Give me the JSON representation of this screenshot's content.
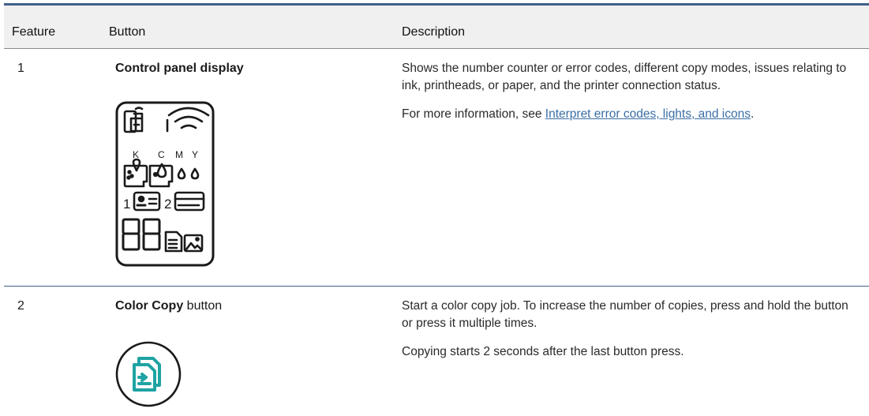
{
  "table": {
    "headers": {
      "feature": "Feature",
      "button": "Button",
      "description": "Description"
    },
    "rows": [
      {
        "feature": "1",
        "button_bold": "Control panel display",
        "button_rest": "",
        "description": [
          "Shows the number counter or error codes, different copy modes, issues relating to ink, printheads, or paper, and the printer connection status."
        ],
        "more_prefix": "For more information, see ",
        "more_link": "Interpret error codes, lights, and icons",
        "more_suffix": ".",
        "icon": "control-panel-display-icon",
        "panel_labels": {
          "k": "K",
          "c": "C",
          "m": "M",
          "y": "Y",
          "one": "1",
          "two": "2"
        }
      },
      {
        "feature": "2",
        "button_bold": "Color Copy",
        "button_rest": " button",
        "description": [
          "Start a color copy job. To increase the number of copies, press and hold the button or press it multiple times.",
          "Copying starts 2 seconds after the last button press."
        ],
        "icon": "color-copy-icon"
      }
    ]
  },
  "colors": {
    "rule": "#3f5f8a",
    "header_bg": "#f0f0f0",
    "link": "#3a6ea5",
    "copy_icon": "#1fa3a3"
  }
}
